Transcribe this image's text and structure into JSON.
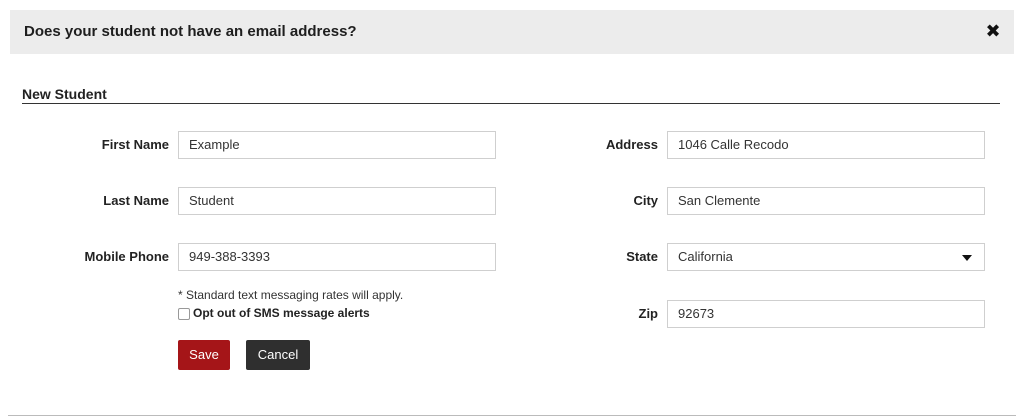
{
  "dialog": {
    "title": "Does your student not have an email address?",
    "close_glyph": "✖"
  },
  "section": {
    "title": "New Student"
  },
  "form": {
    "first_name": {
      "label": "First Name",
      "value": "Example"
    },
    "last_name": {
      "label": "Last Name",
      "value": "Student"
    },
    "mobile_phone": {
      "label": "Mobile Phone",
      "value": "949-388-3393"
    },
    "address": {
      "label": "Address",
      "value": "1046 Calle Recodo"
    },
    "city": {
      "label": "City",
      "value": "San Clemente"
    },
    "state": {
      "label": "State",
      "value": "California"
    },
    "zip": {
      "label": "Zip",
      "value": "92673"
    },
    "sms_note": "* Standard text messaging rates will apply.",
    "sms_opt_out": {
      "label": "Opt out of SMS message alerts",
      "checked": false
    }
  },
  "buttons": {
    "save": "Save",
    "cancel": "Cancel"
  },
  "colors": {
    "save": "#a51518",
    "cancel": "#2f2f2f",
    "header_bg": "#ececec"
  }
}
